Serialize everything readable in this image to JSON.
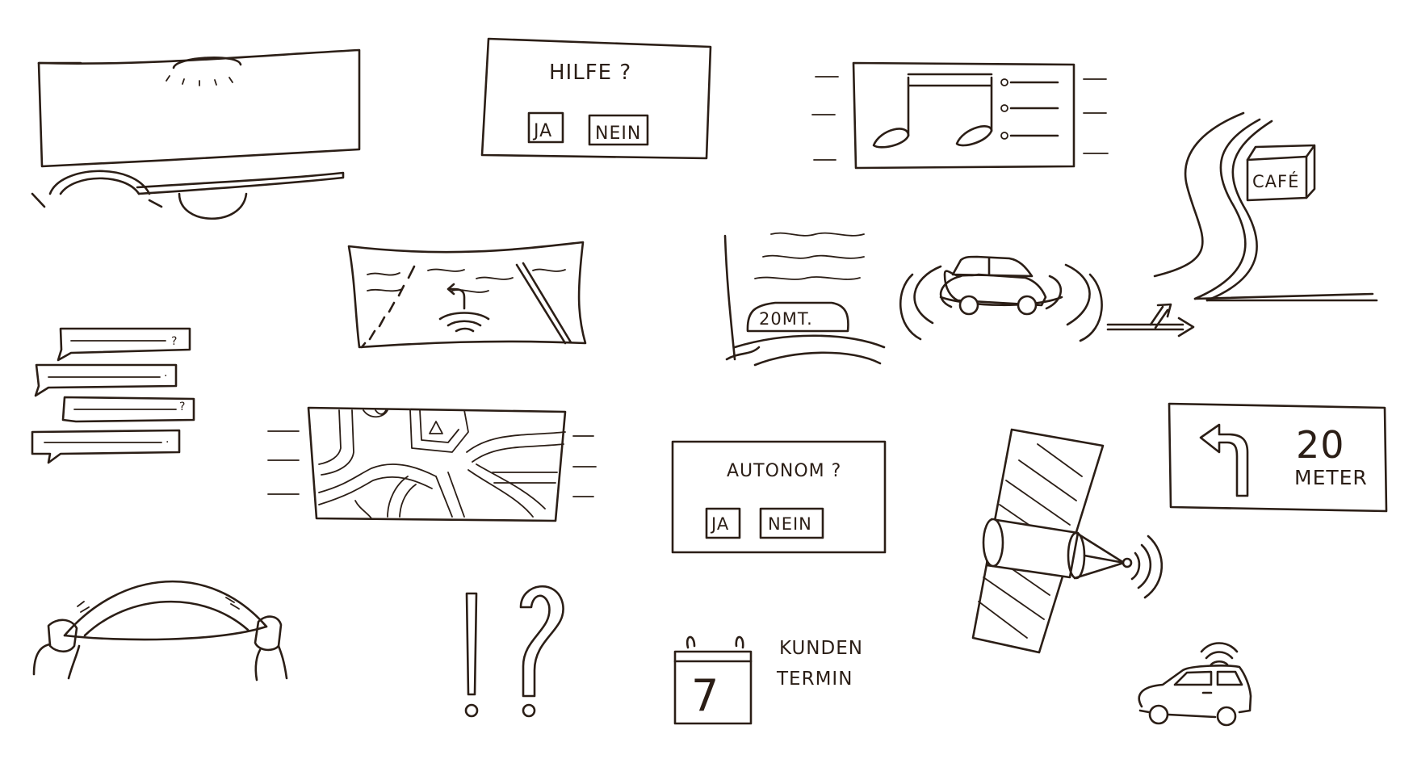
{
  "sketches": {
    "help_prompt": {
      "question": "HILFE ?",
      "yes": "JA",
      "no": "NEIN"
    },
    "autonomous_prompt": {
      "question": "AUTONOM ?",
      "yes": "JA",
      "no": "NEIN"
    },
    "cafe_sign": "CAFÉ",
    "windshield_hud": "20MT.",
    "turn_sign": {
      "number": "20",
      "unit": "METER"
    },
    "calendar": {
      "day": "7",
      "line1": "KUNDEN",
      "line2": "TERMIN"
    },
    "chat_marks": [
      "?",
      "·",
      "?",
      "·"
    ],
    "exclaim_question": "!?"
  }
}
